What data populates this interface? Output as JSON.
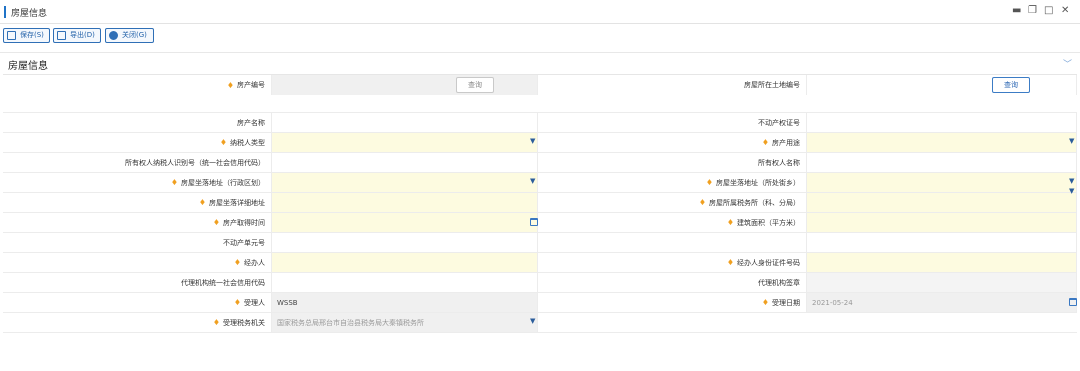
{
  "window": {
    "title": "房屋信息",
    "controls": [
      "minimize-icon",
      "restore-icon",
      "maximize-icon",
      "close-icon"
    ]
  },
  "toolbar": {
    "save_label": "保存(S)",
    "export_label": "导出(D)",
    "close_label": "关闭(G)"
  },
  "section": {
    "title": "房屋信息"
  },
  "form": {
    "property_no": {
      "label": "房产编号",
      "required": "♦",
      "button": "查询"
    },
    "land_no": {
      "label": "房屋所在土地编号",
      "button": "查询"
    },
    "property_name": {
      "label": "房产名称"
    },
    "cert_no": {
      "label": "不动产权证号"
    },
    "taxpayer_type": {
      "label": "纳税人类型",
      "required": "♦"
    },
    "property_use": {
      "label": "房产用途",
      "required": "♦"
    },
    "owner_id": {
      "label": "所有权人纳税人识别号（统一社会信用代码）"
    },
    "owner_name": {
      "label": "所有权人名称"
    },
    "address_district": {
      "label": "房屋坐落地址（行政区划）",
      "required": "♦"
    },
    "address_street": {
      "label": "房屋坐落地址（所处街乡）",
      "required": "♦"
    },
    "address_detail": {
      "label": "房屋坐落详细地址",
      "required": "♦"
    },
    "tax_office": {
      "label": "房屋所属税务所（科、分局）",
      "required": "♦"
    },
    "acquire_time": {
      "label": "房产取得时间",
      "required": "♦"
    },
    "floor_area": {
      "label": "建筑面积（平方米）",
      "required": "♦"
    },
    "unit_no": {
      "label": "不动产单元号"
    },
    "handler": {
      "label": "经办人",
      "required": "♦"
    },
    "handler_id": {
      "label": "经办人身份证件号码",
      "required": "♦"
    },
    "agency_code": {
      "label": "代理机构统一社会信用代码"
    },
    "agency_seal": {
      "label": "代理机构签章"
    },
    "receiver": {
      "label": "受理人",
      "required": "♦",
      "value": "WSSB"
    },
    "receive_date": {
      "label": "受理日期",
      "required": "♦",
      "value": "2021-05-24"
    },
    "receive_office": {
      "label": "受理税务机关",
      "required": "♦",
      "value": "国家税务总局邢台市自治县税务局大秦镇税务所"
    }
  }
}
